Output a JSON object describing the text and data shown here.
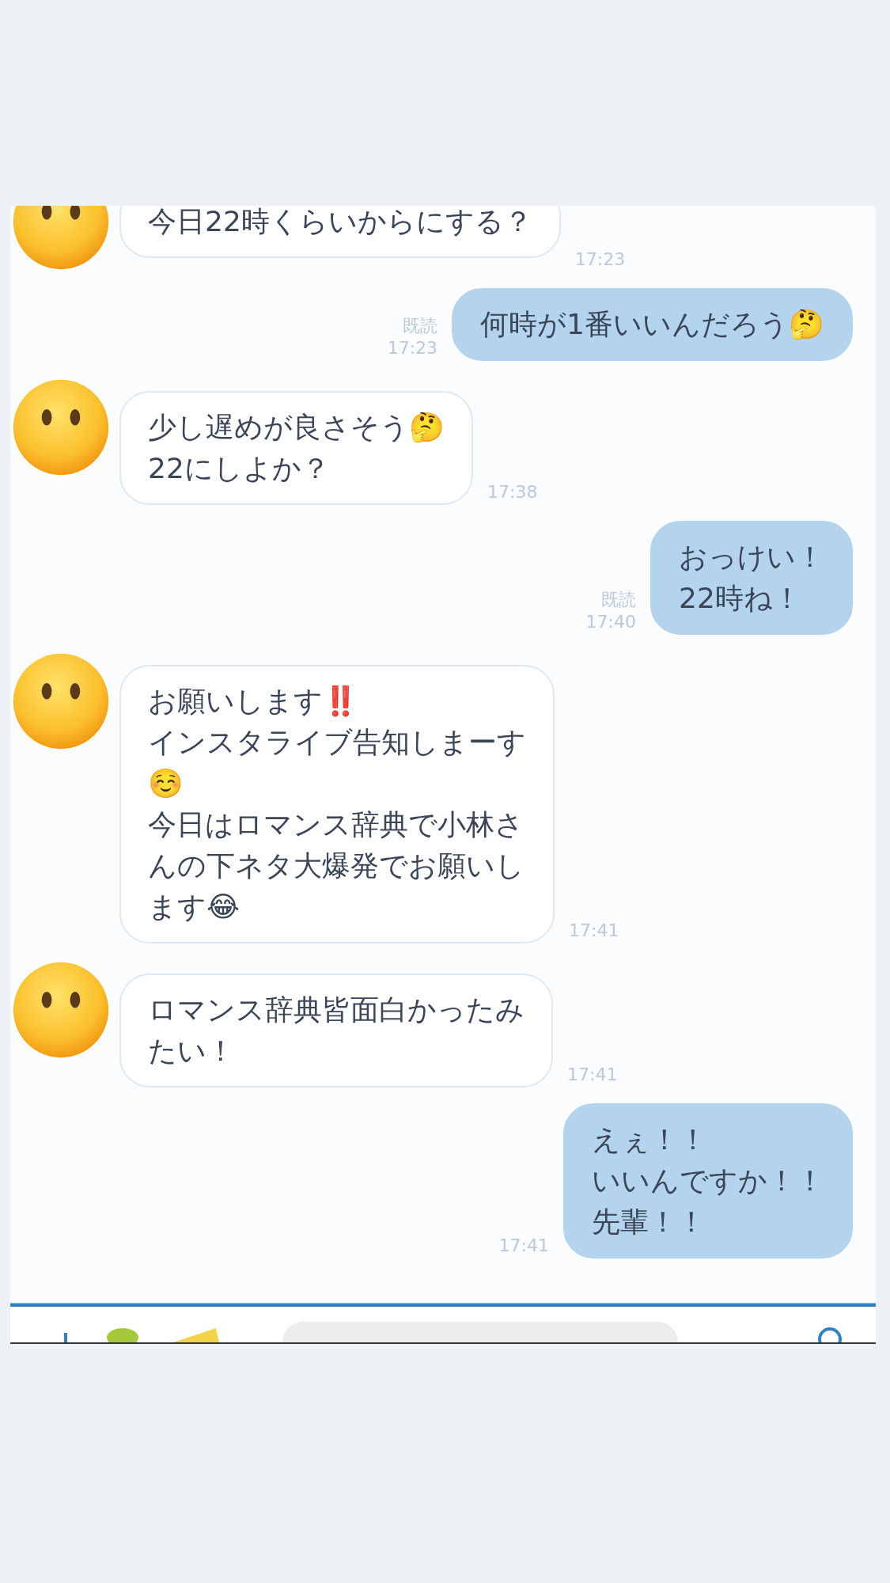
{
  "messages": [
    {
      "kind": "in",
      "lines": [
        "今日22時くらいからにする？"
      ],
      "time": "17:23"
    },
    {
      "kind": "out",
      "lines": [
        "何時が1番いいんだろう🤔"
      ],
      "read_label": "既読",
      "time": "17:23"
    },
    {
      "kind": "in",
      "lines": [
        "少し遅めが良さそう🤔",
        "22にしよか？"
      ],
      "time": "17:38"
    },
    {
      "kind": "out",
      "lines": [
        "おっけい！",
        "22時ね！"
      ],
      "read_label": "既読",
      "time": "17:40"
    },
    {
      "kind": "in",
      "lines": [
        "お願いします‼️",
        "インスタライブ告知しまーす",
        "☺️",
        "今日はロマンス辞典で小林さ",
        "んの下ネタ大爆発でお願いし",
        "ます😂"
      ],
      "time": "17:41"
    },
    {
      "kind": "in",
      "lines": [
        "ロマンス辞典皆面白かったみ",
        "たい！"
      ],
      "time": "17:41"
    },
    {
      "kind": "out",
      "lines": [
        "えぇ！！",
        "いいんですか！！",
        "先輩！！"
      ],
      "time": "17:41"
    }
  ]
}
